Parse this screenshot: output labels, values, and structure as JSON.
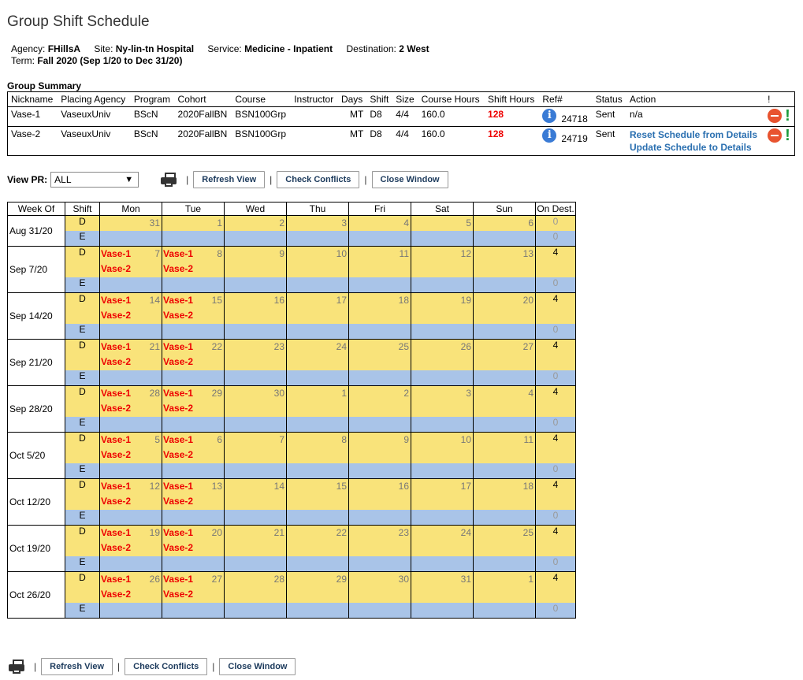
{
  "title": "Group Shift Schedule",
  "meta": {
    "agency_label": "Agency:",
    "agency": "FHillsA",
    "site_label": "Site:",
    "site": "Ny-lin-tn Hospital",
    "service_label": "Service:",
    "service": "Medicine - Inpatient",
    "destination_label": "Destination:",
    "destination": "2 West",
    "term_label": "Term:",
    "term": "Fall 2020",
    "term_range": "(Sep 1/20 to Dec 31/20)"
  },
  "group_summary": {
    "label": "Group Summary",
    "columns": [
      "Nickname",
      "Placing Agency",
      "Program",
      "Cohort",
      "Course",
      "Instructor",
      "Days",
      "Shift",
      "Size",
      "Course Hours",
      "Shift Hours",
      "Ref#",
      "Status",
      "Action",
      "!"
    ],
    "rows": [
      {
        "nickname": "Vase-1",
        "agency": "VaseuxUniv",
        "program": "BScN",
        "cohort": "2020FallBN",
        "course": "BSN100Grp",
        "instructor": "",
        "days": "MT",
        "shift": "D8",
        "size": "4/4",
        "course_hours": "160.0",
        "shift_hours": "128",
        "ref": "24718",
        "status": "Sent",
        "action": "n/a"
      },
      {
        "nickname": "Vase-2",
        "agency": "VaseuxUniv",
        "program": "BScN",
        "cohort": "2020FallBN",
        "course": "BSN100Grp",
        "instructor": "",
        "days": "MT",
        "shift": "D8",
        "size": "4/4",
        "course_hours": "160.0",
        "shift_hours": "128",
        "ref": "24719",
        "status": "Sent",
        "action1": "Reset Schedule from Details",
        "action2": "Update Schedule to Details"
      }
    ]
  },
  "toolbar": {
    "view_pr_label": "View PR:",
    "view_pr_value": "ALL",
    "refresh": "Refresh View",
    "check": "Check Conflicts",
    "close": "Close Window",
    "sep": "|"
  },
  "calendar": {
    "headers": [
      "Week Of",
      "Shift",
      "Mon",
      "Tue",
      "Wed",
      "Thu",
      "Fri",
      "Sat",
      "Sun",
      "On Dest."
    ],
    "weeks": [
      {
        "label": "Aug 31/20",
        "days": [
          "31",
          "1",
          "2",
          "3",
          "4",
          "5",
          "6"
        ],
        "groups": false,
        "d_on": "0",
        "e_on": "0"
      },
      {
        "label": "Sep 7/20",
        "days": [
          "7",
          "8",
          "9",
          "10",
          "11",
          "12",
          "13"
        ],
        "groups": true,
        "d_on": "4",
        "e_on": "0"
      },
      {
        "label": "Sep 14/20",
        "days": [
          "14",
          "15",
          "16",
          "17",
          "18",
          "19",
          "20"
        ],
        "groups": true,
        "d_on": "4",
        "e_on": "0"
      },
      {
        "label": "Sep 21/20",
        "days": [
          "21",
          "22",
          "23",
          "24",
          "25",
          "26",
          "27"
        ],
        "groups": true,
        "d_on": "4",
        "e_on": "0"
      },
      {
        "label": "Sep 28/20",
        "days": [
          "28",
          "29",
          "30",
          "1",
          "2",
          "3",
          "4"
        ],
        "groups": true,
        "d_on": "4",
        "e_on": "0"
      },
      {
        "label": "Oct 5/20",
        "days": [
          "5",
          "6",
          "7",
          "8",
          "9",
          "10",
          "11"
        ],
        "groups": true,
        "d_on": "4",
        "e_on": "0"
      },
      {
        "label": "Oct 12/20",
        "days": [
          "12",
          "13",
          "14",
          "15",
          "16",
          "17",
          "18"
        ],
        "groups": true,
        "d_on": "4",
        "e_on": "0"
      },
      {
        "label": "Oct 19/20",
        "days": [
          "19",
          "20",
          "21",
          "22",
          "23",
          "24",
          "25"
        ],
        "groups": true,
        "d_on": "4",
        "e_on": "0"
      },
      {
        "label": "Oct 26/20",
        "days": [
          "26",
          "27",
          "28",
          "29",
          "30",
          "31",
          "1"
        ],
        "groups": true,
        "d_on": "4",
        "e_on": "0"
      }
    ],
    "shift_d": "D",
    "shift_e": "E",
    "group_names": [
      "Vase-1",
      "Vase-2"
    ]
  }
}
